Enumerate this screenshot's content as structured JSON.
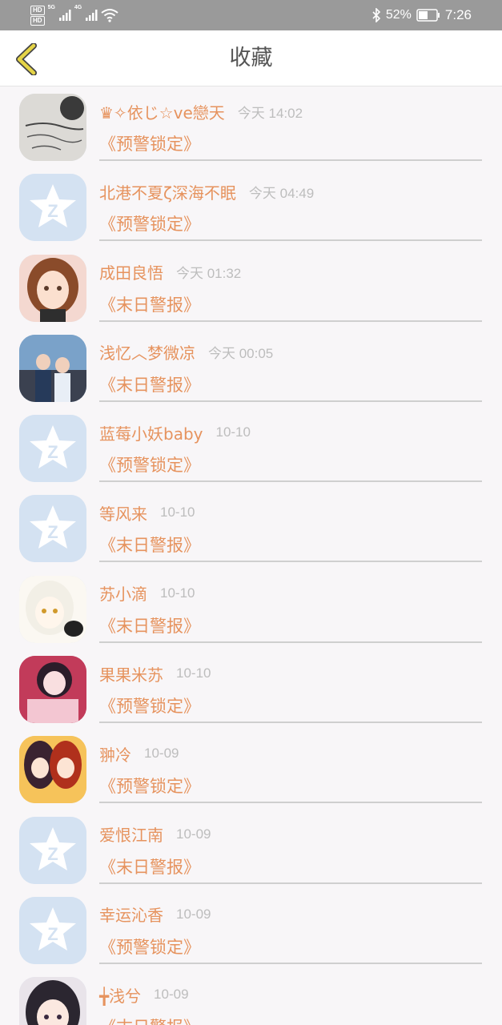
{
  "status_bar": {
    "hd1": "HD",
    "hd2": "HD",
    "net1": "5G",
    "net2": "4G",
    "battery_pct": "52%",
    "time": "7:26",
    "battery_level": 0.52
  },
  "header": {
    "title": "收藏"
  },
  "colors": {
    "accent": "#e6935e",
    "back_icon": "#e5d447",
    "meta_gray": "#bdbdbd",
    "placeholder_avatar": "#d4e2f2"
  },
  "favorites": [
    {
      "name": "♛✧依じ☆ve戀天",
      "time": "今天 14:02",
      "title": "《预警锁定》",
      "avatar": "sketch"
    },
    {
      "name": "北港不夏ζ深海不眠",
      "time": "今天 04:49",
      "title": "《预警锁定》",
      "avatar": "default"
    },
    {
      "name": "成田良悟",
      "time": "今天 01:32",
      "title": "《末日警报》",
      "avatar": "anime-girl-brown-hair"
    },
    {
      "name": "浅忆︿梦微凉",
      "time": "今天 00:05",
      "title": "《末日警报》",
      "avatar": "couple-photo"
    },
    {
      "name": "蓝莓小妖baby",
      "time": "10-10",
      "title": "《预警锁定》",
      "avatar": "default"
    },
    {
      "name": "等风来",
      "time": "10-10",
      "title": "《末日警报》",
      "avatar": "default"
    },
    {
      "name": "苏小滴",
      "time": "10-10",
      "title": "《末日警报》",
      "avatar": "anime-girl-white-hair"
    },
    {
      "name": "果果米苏",
      "time": "10-10",
      "title": "《预警锁定》",
      "avatar": "anime-girl-pink"
    },
    {
      "name": "翀冷",
      "time": "10-09",
      "title": "《预警锁定》",
      "avatar": "anime-twins"
    },
    {
      "name": "爱恨江南",
      "time": "10-09",
      "title": "《末日警报》",
      "avatar": "default"
    },
    {
      "name": "幸运沁香",
      "time": "10-09",
      "title": "《预警锁定》",
      "avatar": "default"
    },
    {
      "name": "╈浅兮",
      "time": "10-09",
      "title": "《末日警报》",
      "avatar": "anime-girl-dark-hair"
    }
  ]
}
